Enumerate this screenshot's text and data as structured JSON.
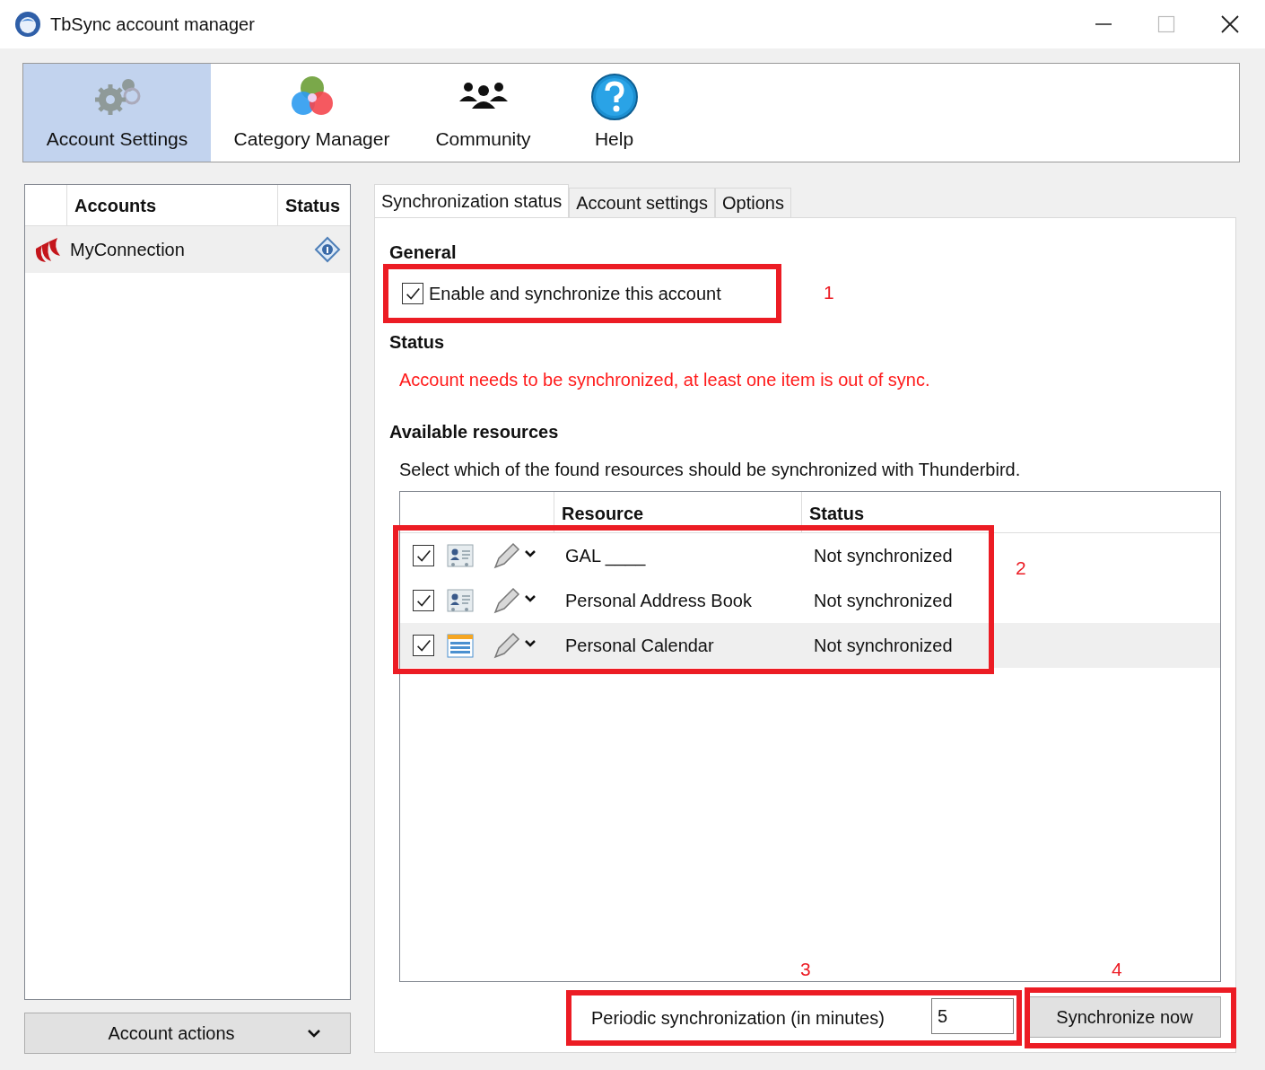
{
  "window": {
    "title": "TbSync account manager"
  },
  "toolbar": [
    {
      "label": "Account Settings",
      "kind": "gears",
      "selected": true
    },
    {
      "label": "Category Manager",
      "kind": "circles",
      "selected": false
    },
    {
      "label": "Community",
      "kind": "people",
      "selected": false
    },
    {
      "label": "Help",
      "kind": "help",
      "selected": false
    }
  ],
  "accounts": {
    "columns": [
      "Accounts",
      "Status"
    ],
    "rows": [
      {
        "name": "MyConnection",
        "selected": true
      }
    ]
  },
  "account_actions": "Account actions",
  "tabs": [
    {
      "label": "Synchronization status",
      "selected": true
    },
    {
      "label": "Account settings",
      "selected": false
    },
    {
      "label": "Options",
      "selected": false
    }
  ],
  "general": {
    "heading": "General",
    "enable": {
      "label": "Enable and synchronize this account",
      "checked": true
    }
  },
  "status": {
    "heading": "Status",
    "message": "Account needs to be synchronized, at least one item is out of sync."
  },
  "resources": {
    "heading": "Available resources",
    "description": "Select which of the found resources should be synchronized with Thunderbird.",
    "columns": [
      "Resource",
      "Status"
    ],
    "rows": [
      {
        "checked": true,
        "kind": "addressbook",
        "name": "GAL ____",
        "status": "Not synchronized",
        "selected": false
      },
      {
        "checked": true,
        "kind": "addressbook",
        "name": "Personal Address Book",
        "status": "Not synchronized",
        "selected": false
      },
      {
        "checked": true,
        "kind": "calendar",
        "name": "Personal Calendar",
        "status": "Not synchronized",
        "selected": true
      }
    ]
  },
  "periodic": {
    "label": "Periodic synchronization (in minutes)",
    "value": "5"
  },
  "sync_button": "Synchronize now",
  "annotations": [
    {
      "label": "1"
    },
    {
      "label": "2"
    },
    {
      "label": "3"
    },
    {
      "label": "4"
    }
  ]
}
